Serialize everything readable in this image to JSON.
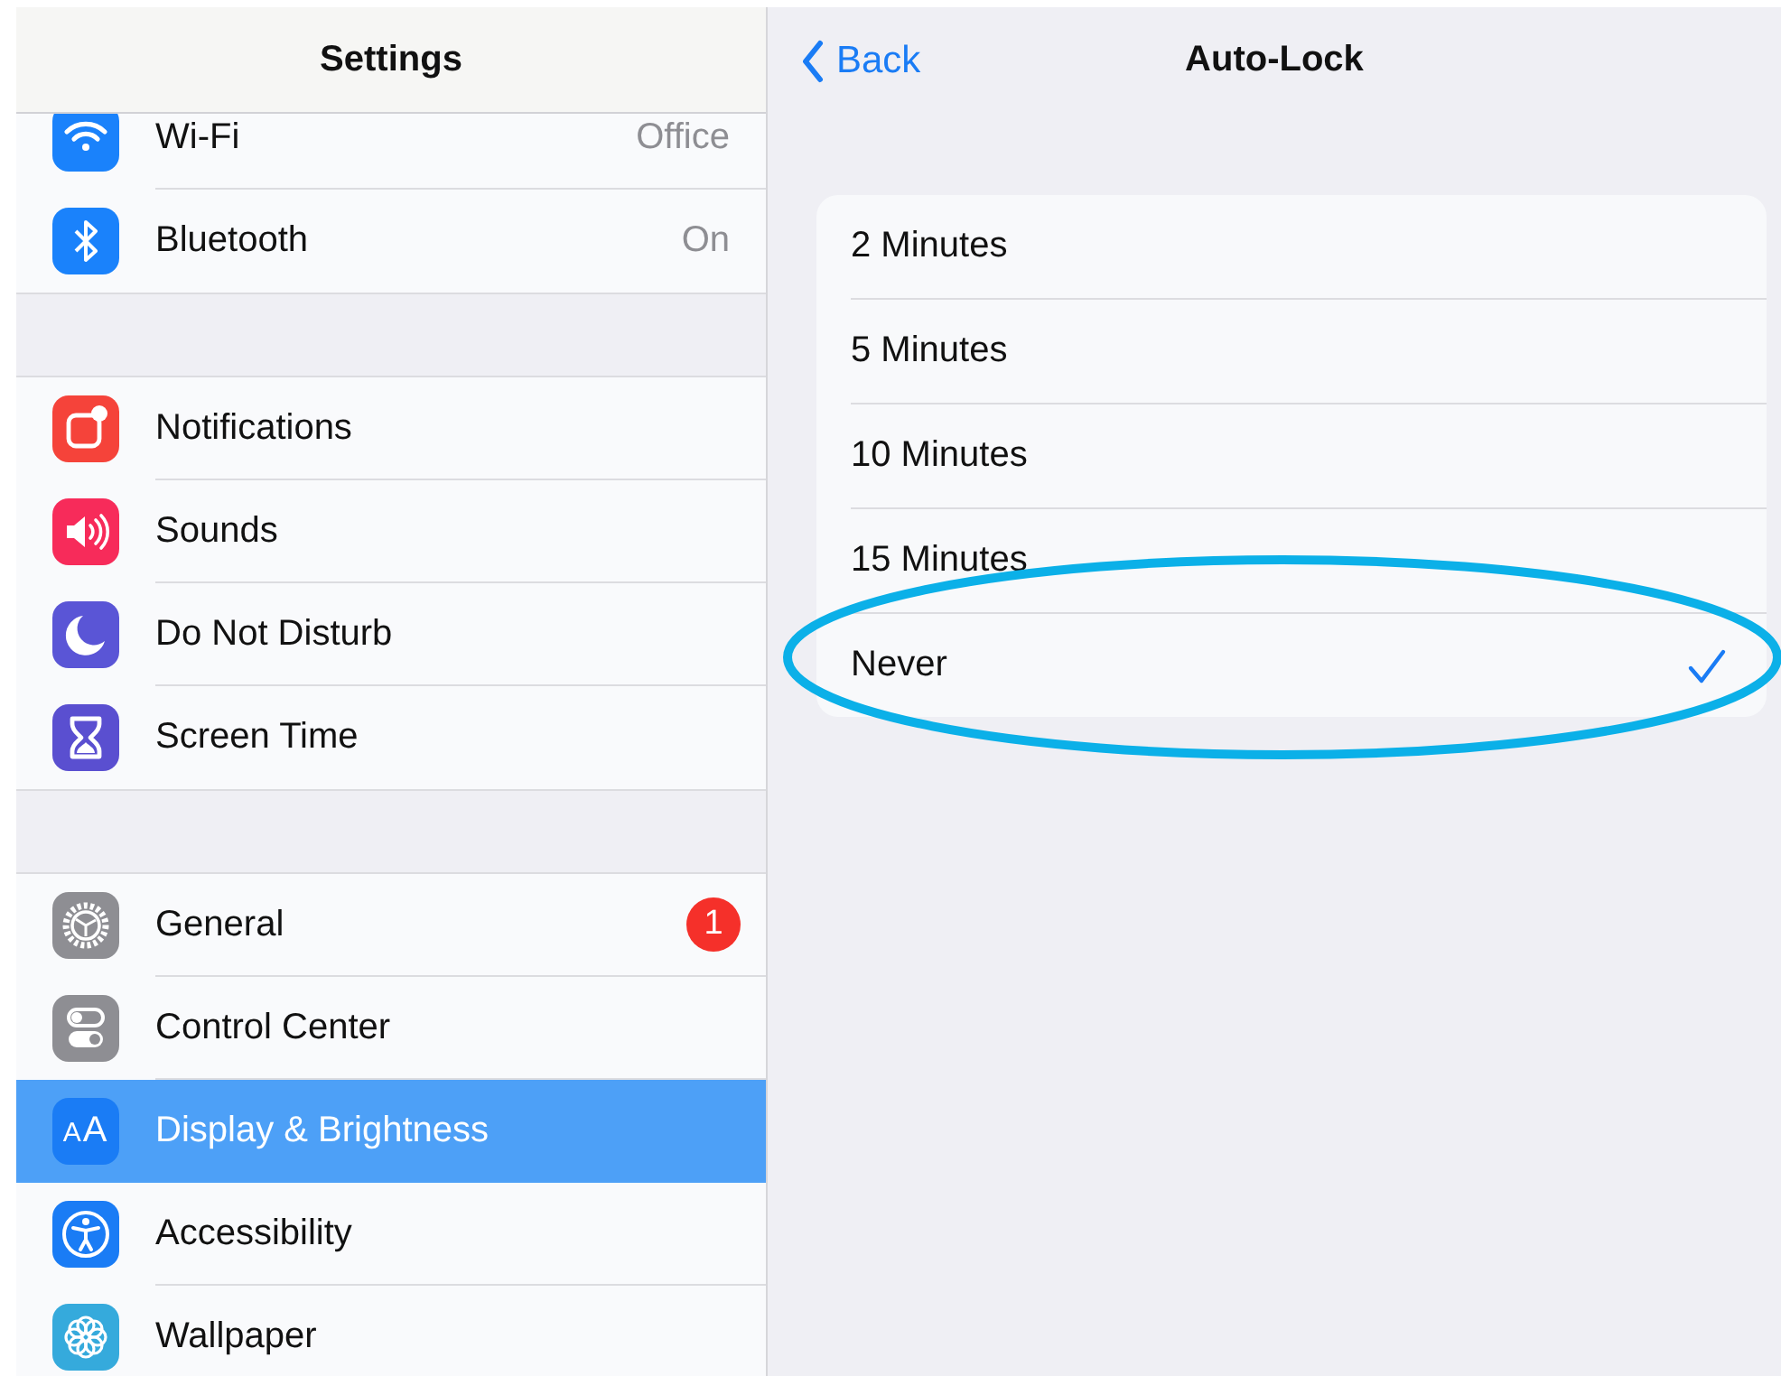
{
  "sidebar": {
    "title": "Settings",
    "groups": [
      {
        "items": [
          {
            "label": "Wi-Fi",
            "value": "Office",
            "color": "#1a82fb",
            "selected": false
          },
          {
            "label": "Bluetooth",
            "value": "On",
            "color": "#1a82fb",
            "selected": false
          }
        ]
      },
      {
        "items": [
          {
            "label": "Notifications",
            "color": "#f5433a",
            "selected": false
          },
          {
            "label": "Sounds",
            "color": "#f72b5a",
            "selected": false
          },
          {
            "label": "Do Not Disturb",
            "color": "#5a55d6",
            "selected": false
          },
          {
            "label": "Screen Time",
            "color": "#5a4fd0",
            "selected": false
          }
        ]
      },
      {
        "items": [
          {
            "label": "General",
            "badge": "1",
            "color": "#8e8e93",
            "selected": false
          },
          {
            "label": "Control Center",
            "color": "#8e8e93",
            "selected": false
          },
          {
            "label": "Display & Brightness",
            "icon_text": "AA",
            "color": "#1a7cf5",
            "selected": true
          },
          {
            "label": "Accessibility",
            "color": "#1a7cf5",
            "selected": false
          },
          {
            "label": "Wallpaper",
            "color": "#35aadc",
            "selected": false
          }
        ]
      }
    ]
  },
  "detail": {
    "back": "Back",
    "title": "Auto-Lock",
    "options": [
      {
        "label": "2 Minutes",
        "selected": false
      },
      {
        "label": "5 Minutes",
        "selected": false
      },
      {
        "label": "10 Minutes",
        "selected": false
      },
      {
        "label": "15 Minutes",
        "selected": false
      },
      {
        "label": "Never",
        "selected": true
      }
    ]
  }
}
